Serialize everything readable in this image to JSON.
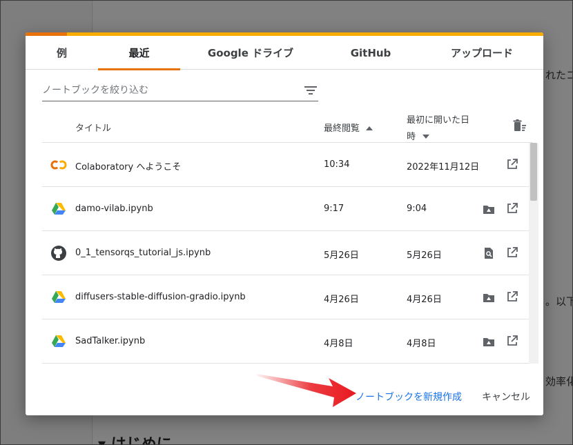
{
  "background": {
    "text_top_right": "れたコ",
    "text_mid_right": "。以下",
    "text_low_right": "効率化し",
    "heading": "▾ はじめに"
  },
  "dialog": {
    "tabs": [
      {
        "label": "例",
        "active": false
      },
      {
        "label": "最近",
        "active": true
      },
      {
        "label": "Google ドライブ",
        "active": false
      },
      {
        "label": "GitHub",
        "active": false
      },
      {
        "label": "アップロード",
        "active": false
      }
    ],
    "filter": {
      "placeholder": "ノートブックを絞り込む",
      "icon": "filter-list-icon"
    },
    "columns": {
      "title": "タイトル",
      "last_viewed": "最終閲覧",
      "first_opened_line1": "最初に開いた日",
      "first_opened_line2": "時",
      "trash_icon": "delete-icon"
    },
    "rows": [
      {
        "icon": "colab-icon",
        "title": "Colaboratory へようこそ",
        "last_viewed": "10:34",
        "first_opened": "2022年11月12日",
        "action1": "",
        "action2": "open-in-new-icon"
      },
      {
        "icon": "google-drive-icon",
        "title": "damo-vilab.ipynb",
        "last_viewed": "9:17",
        "first_opened": "9:04",
        "action1": "drive-folder-icon",
        "action2": "open-in-new-icon"
      },
      {
        "icon": "github-icon",
        "title": "0_1_tensorqs_tutorial_js.ipynb",
        "last_viewed": "5月26日",
        "first_opened": "5月26日",
        "action1": "search-file-icon",
        "action2": "open-in-new-icon"
      },
      {
        "icon": "google-drive-icon",
        "title": "diffusers-stable-diffusion-gradio.ipynb",
        "last_viewed": "4月26日",
        "first_opened": "4月26日",
        "action1": "drive-folder-icon",
        "action2": "open-in-new-icon"
      },
      {
        "icon": "google-drive-icon",
        "title": "SadTalker.ipynb",
        "last_viewed": "4月8日",
        "first_opened": "4月8日",
        "action1": "drive-folder-icon",
        "action2": "open-in-new-icon"
      }
    ],
    "footer": {
      "new_notebook": "ノートブックを新規作成",
      "cancel": "キャンセル"
    },
    "colors": {
      "accent_orange": "#e8710a",
      "accent_yellow": "#f9ab00",
      "link_blue": "#1a73e8",
      "annotation_arrow": "#e8191f"
    }
  }
}
